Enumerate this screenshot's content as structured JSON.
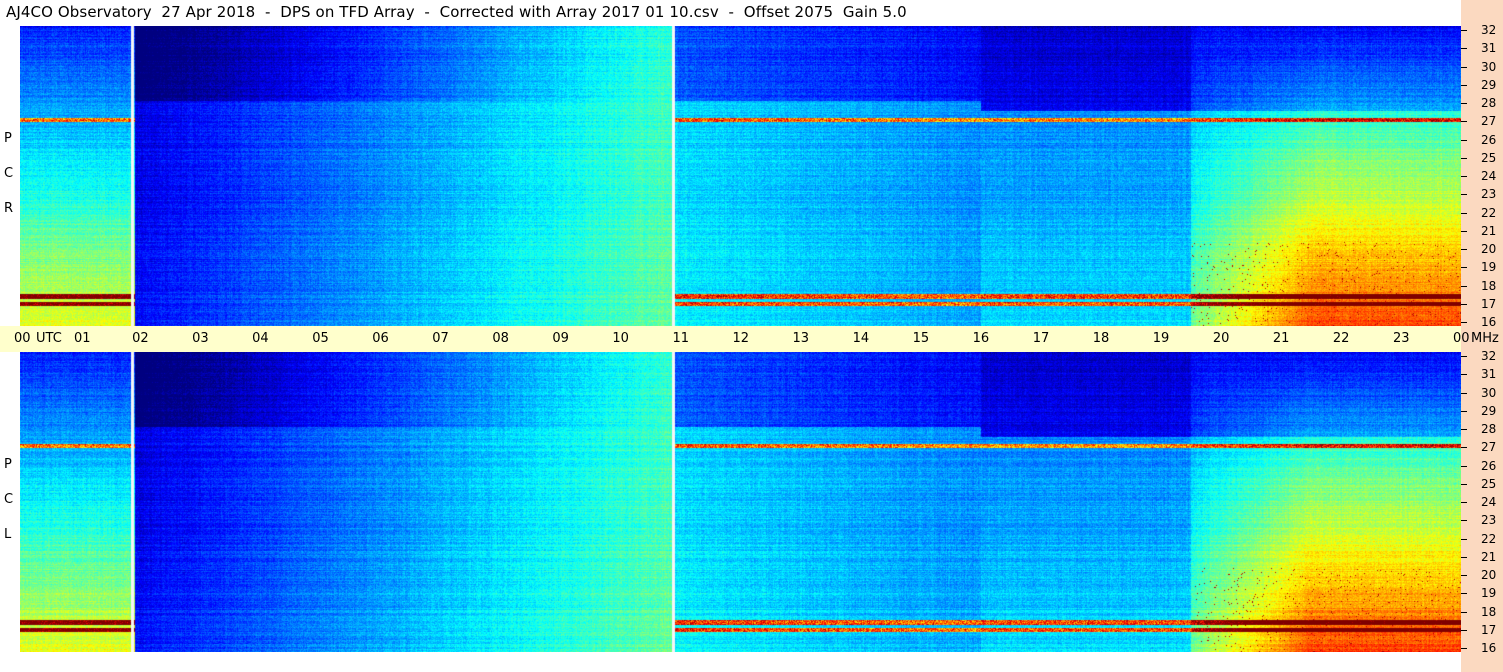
{
  "title": "AJ4CO Observatory  27 Apr 2018  -  DPS on TFD Array  -  Corrected with Array 2017 01 10.csv  -  Offset 2075  Gain 5.0",
  "panels": [
    {
      "id": "rcp",
      "label_chars": [
        "P",
        "C",
        "R"
      ]
    },
    {
      "id": "lcp",
      "label_chars": [
        "P",
        "C",
        "L"
      ]
    }
  ],
  "time_axis": {
    "labels": [
      "00",
      "UTC",
      "01",
      "02",
      "03",
      "04",
      "05",
      "06",
      "07",
      "08",
      "09",
      "10",
      "11",
      "12",
      "13",
      "14",
      "15",
      "16",
      "17",
      "18",
      "19",
      "20",
      "21",
      "22",
      "23",
      "00",
      "MHz"
    ]
  },
  "freq_axis": {
    "labels": [
      "32",
      "31",
      "30",
      "29",
      "28",
      "27",
      "26",
      "25",
      "24",
      "23",
      "22",
      "21",
      "20",
      "19",
      "18",
      "17",
      "16"
    ]
  },
  "chart_data": [
    {
      "type": "heatmap",
      "title": "RCP",
      "xlabel": "UTC",
      "ylabel": "MHz",
      "x_ticks": [
        "00",
        "01",
        "02",
        "03",
        "04",
        "05",
        "06",
        "07",
        "08",
        "09",
        "10",
        "11",
        "12",
        "13",
        "14",
        "15",
        "16",
        "17",
        "18",
        "19",
        "20",
        "21",
        "22",
        "23",
        "00"
      ],
      "y_ticks": [
        32,
        31,
        30,
        29,
        28,
        27,
        26,
        25,
        24,
        23,
        22,
        21,
        20,
        19,
        18,
        17,
        16
      ],
      "xlim_hours_utc": [
        0,
        24
      ],
      "ylim_mhz": [
        16,
        32
      ],
      "data_gaps_utc": [
        1.87,
        10.87
      ],
      "interference_bands_mhz": [
        27.0,
        17.6,
        17.2
      ]
    },
    {
      "type": "heatmap",
      "title": "LCP",
      "xlabel": "UTC",
      "ylabel": "MHz",
      "x_ticks": [
        "00",
        "01",
        "02",
        "03",
        "04",
        "05",
        "06",
        "07",
        "08",
        "09",
        "10",
        "11",
        "12",
        "13",
        "14",
        "15",
        "16",
        "17",
        "18",
        "19",
        "20",
        "21",
        "22",
        "23",
        "00"
      ],
      "y_ticks": [
        32,
        31,
        30,
        29,
        28,
        27,
        26,
        25,
        24,
        23,
        22,
        21,
        20,
        19,
        18,
        17,
        16
      ],
      "xlim_hours_utc": [
        0,
        24
      ],
      "ylim_mhz": [
        16,
        32
      ],
      "data_gaps_utc": [
        1.87,
        10.87
      ],
      "interference_bands_mhz": [
        27.0,
        17.6,
        17.2
      ]
    }
  ]
}
